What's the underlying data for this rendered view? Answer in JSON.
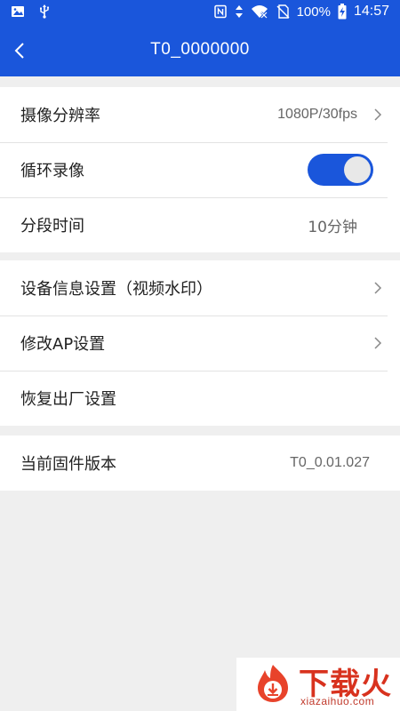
{
  "status_bar": {
    "battery": "100%",
    "time": "14:57",
    "left_icons": [
      "image-icon",
      "usb-icon"
    ],
    "right_icons": [
      "nfc-icon",
      "data-arrows-icon",
      "wifi-off-icon",
      "no-sim-icon",
      "battery-charging-icon"
    ]
  },
  "header": {
    "title": "T0_0000000",
    "back_icon": "chevron-left-icon"
  },
  "groups": {
    "camera": {
      "resolution": {
        "label": "摄像分辨率",
        "value": "1080P/30fps"
      },
      "loop_recording": {
        "label": "循环录像",
        "enabled": true
      },
      "segment_time": {
        "label": "分段时间",
        "value": "10分钟"
      }
    },
    "device": {
      "info_settings": {
        "label": "设备信息设置（视频水印）"
      },
      "ap_settings": {
        "label": "修改AP设置"
      },
      "factory_reset": {
        "label": "恢复出厂设置"
      }
    },
    "firmware": {
      "label": "当前固件版本",
      "value": "T0_0.01.027"
    }
  },
  "watermark": {
    "title": "下载火",
    "subtitle": "xiazaihuo.com"
  },
  "colors": {
    "brand_blue": "#1a56db",
    "background": "#efefef",
    "watermark_red": "#d8321e"
  }
}
